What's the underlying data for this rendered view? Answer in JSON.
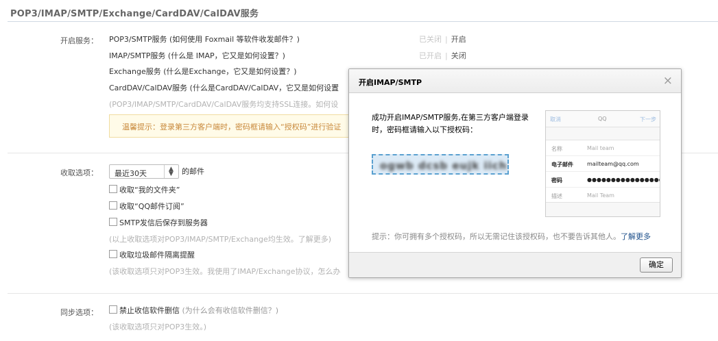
{
  "section_title": "POP3/IMAP/SMTP/Exchange/CardDAV/CalDAV服务",
  "services": {
    "label": "开启服务：",
    "items": [
      {
        "name": "POP3/SMTP服务 (如何使用 Foxmail 等软件收发邮件？)",
        "status": "已关闭",
        "action": "开启"
      },
      {
        "name": "IMAP/SMTP服务 (什么是 IMAP，它又是如何设置？)",
        "status": "已开启",
        "action": "关闭"
      },
      {
        "name": "Exchange服务 (什么是Exchange，它又是如何设置？)",
        "status": "",
        "action": ""
      },
      {
        "name": "CardDAV/CalDAV服务 (什么是CardDAV/CalDAV，它又是如何设置",
        "status": "",
        "action": ""
      }
    ],
    "ssl_note": "(POP3/IMAP/SMTP/CardDAV/CalDAV服务均支持SSL连接。如何设",
    "tip": "温馨提示：登录第三方客户端时，密码框请输入“授权码”进行验证"
  },
  "receive": {
    "label": "收取选项：",
    "select_value": "最近30天",
    "after_select": "的邮件",
    "options": [
      {
        "label": "收取“我的文件夹”",
        "checked": false
      },
      {
        "label": "收取“QQ邮件订阅”",
        "checked": false
      },
      {
        "label": "SMTP发信后保存到服务器",
        "checked": false
      }
    ],
    "note1": "(以上收取选项对POP3/IMAP/SMTP/Exchange均生效。了解更多)",
    "spam_label": "收取垃圾邮件隔离提醒",
    "note2": "(该收取选项只对POP3生效。我使用了IMAP/Exchange协议，怎么办"
  },
  "sync": {
    "label": "同步选项：",
    "option": "禁止收信软件删信",
    "option_hint": "(为什么会有收信软件删信？)",
    "note": "(该收取选项只对POP3生效。)"
  },
  "dialog": {
    "title": "开启IMAP/SMTP",
    "close": "×",
    "message": "成功开启IMAP/SMTP服务,在第三方客户端登录时，密码框请输入以下授权码：",
    "auth_code": "ogwb dcsb eujk iich",
    "hint": "提示：你可拥有多个授权码，所以无需记住该授权码，也不要告诉其他人。",
    "hint_link": "了解更多",
    "ok": "确定",
    "phone": {
      "cancel": "取消",
      "qq": "QQ",
      "next": "下一步",
      "rows": [
        {
          "key": "名称",
          "value": "Mail team"
        },
        {
          "key": "电子邮件",
          "value": "mailteam@qq.com"
        },
        {
          "key": "密码",
          "value": "●●●●●●●●●●●●●●●●"
        },
        {
          "key": "描述",
          "value": "Mail Team"
        }
      ]
    }
  }
}
